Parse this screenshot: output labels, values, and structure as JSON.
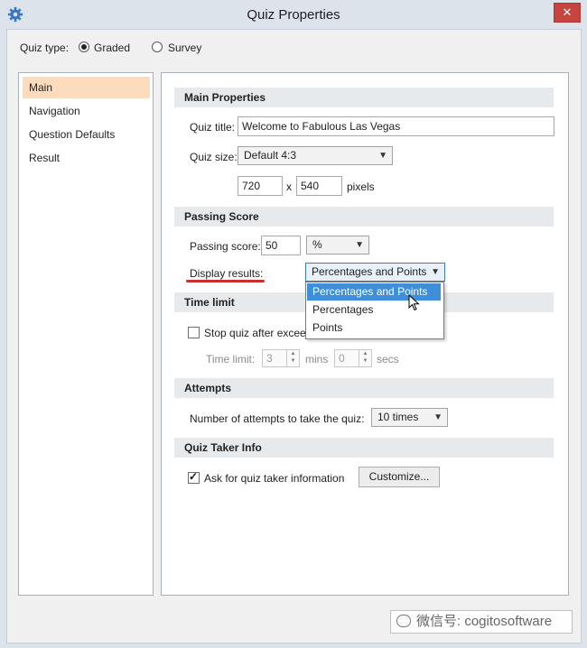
{
  "window": {
    "title": "Quiz Properties",
    "close_glyph": "✕"
  },
  "quiz_type": {
    "label": "Quiz type:",
    "options": [
      "Graded",
      "Survey"
    ],
    "selected": "Graded"
  },
  "nav": {
    "items": [
      "Main",
      "Navigation",
      "Question Defaults",
      "Result"
    ],
    "selected": "Main"
  },
  "main_properties": {
    "heading": "Main Properties",
    "quiz_title_label": "Quiz title:",
    "quiz_title_value": "Welcome to Fabulous Las Vegas",
    "quiz_size_label": "Quiz size:",
    "quiz_size_value": "Default 4:3",
    "width": "720",
    "x_sep": "x",
    "height": "540",
    "pixels_label": "pixels"
  },
  "passing_score": {
    "heading": "Passing Score",
    "label": "Passing score:",
    "value": "50",
    "unit": "%",
    "display_results_label": "Display results:",
    "display_results_value": "Percentages and Points",
    "dropdown_options": [
      "Percentages and Points",
      "Percentages",
      "Points"
    ],
    "highlighted_option": "Percentages and Points"
  },
  "time_limit": {
    "heading": "Time limit",
    "stop_quiz_label": "Stop quiz after exceeding",
    "stop_quiz_checked": false,
    "time_limit_label": "Time limit:",
    "minutes": "3",
    "mins_label": "mins",
    "seconds": "0",
    "secs_label": "secs"
  },
  "attempts": {
    "heading": "Attempts",
    "label": "Number of attempts to take the quiz:",
    "value": "10 times"
  },
  "quiz_taker_info": {
    "heading": "Quiz Taker Info",
    "ask_label": "Ask for quiz taker information",
    "ask_checked": true,
    "customize_button": "Customize..."
  },
  "watermark": {
    "text": "微信号: cogitosoftware"
  },
  "colors": {
    "selected_nav": "#fcdcbc",
    "highlight": "#3e8ed9",
    "close": "#c7443f",
    "annotation": "#c9302c"
  },
  "icons": {
    "app": "gear-icon",
    "close": "close-icon",
    "combo": "chevron-down-icon",
    "cursor": "mouse-pointer-icon"
  }
}
